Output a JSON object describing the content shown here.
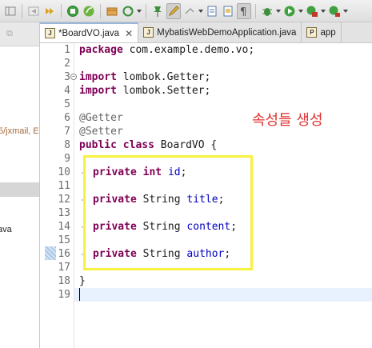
{
  "toolbar": {
    "buttons": [
      "new-icon",
      "save-icon",
      "debug-icon",
      "run-icon",
      "spring-boot-icon",
      "package-icon",
      "refresh-icon",
      "pin-icon",
      "pen-icon",
      "arrow-icon",
      "list-icon",
      "file-icon",
      "paragraph-icon",
      "bug-icon",
      "run-play-icon",
      "coverage-icon",
      "external-tool-icon"
    ]
  },
  "left_panel": {
    "path_text": "5/jxmail, E",
    "java_text": "ava"
  },
  "tabs": [
    {
      "label": "*BoardVO.java",
      "active": true,
      "close": "✕"
    },
    {
      "label": "MybatisWebDemoApplication.java",
      "active": false
    },
    {
      "label": "app",
      "active": false
    }
  ],
  "editor": {
    "line_numbers": [
      "1",
      "2",
      "3",
      "4",
      "5",
      "6",
      "7",
      "8",
      "9",
      "10",
      "11",
      "12",
      "13",
      "14",
      "15",
      "16",
      "17",
      "18",
      "19"
    ],
    "lines": {
      "l1_kw": "package",
      "l1_rest": " com.example.demo.vo;",
      "l3_kw": "import",
      "l3_rest": " lombok.Getter;",
      "l4_kw": "import",
      "l4_rest": " lombok.Setter;",
      "l6": "@Getter",
      "l7": "@Setter",
      "l8_kw1": "public",
      "l8_kw2": "class",
      "l8_rest": " BoardVO {",
      "l10_kw1": "private",
      "l10_kw2": "int",
      "l10_fld": "id",
      "l12_kw": "private",
      "l12_type": " String ",
      "l12_fld": "title",
      "l14_kw": "private",
      "l14_type": " String ",
      "l14_fld": "content",
      "l16_kw": "private",
      "l16_type": " String ",
      "l16_fld": "author",
      "l18": "}",
      "semi": ";"
    },
    "annotation_note": "속성들 생성"
  }
}
